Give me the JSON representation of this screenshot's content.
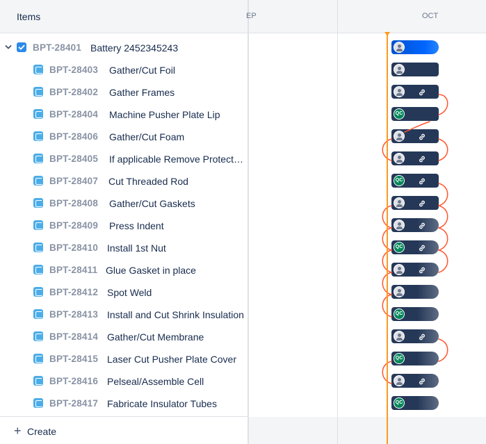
{
  "left_panel": {
    "header_title": "Items",
    "parent": {
      "key": "BPT-28401",
      "summary": "Battery 2452345243"
    },
    "children": [
      {
        "key": "BPT-28403",
        "summary": "Gather/Cut Foil"
      },
      {
        "key": "BPT-28402",
        "summary": "Gather Frames"
      },
      {
        "key": "BPT-28404",
        "summary": "Machine Pusher Plate Lip"
      },
      {
        "key": "BPT-28406",
        "summary": "Gather/Cut Foam"
      },
      {
        "key": "BPT-28405",
        "summary": "If applicable Remove Protect…"
      },
      {
        "key": "BPT-28407",
        "summary": "Cut Threaded Rod"
      },
      {
        "key": "BPT-28408",
        "summary": "Gather/Cut Gaskets"
      },
      {
        "key": "BPT-28409",
        "summary": "Press Indent"
      },
      {
        "key": "BPT-28410",
        "summary": "Install 1st Nut"
      },
      {
        "key": "BPT-28411",
        "summary": "Glue Gasket in place"
      },
      {
        "key": "BPT-28412",
        "summary": "Spot Weld"
      },
      {
        "key": "BPT-28413",
        "summary": "Install and Cut Shrink Insulation"
      },
      {
        "key": "BPT-28414",
        "summary": "Gather/Cut Membrane"
      },
      {
        "key": "BPT-28415",
        "summary": "Laser Cut Pusher Plate Cover"
      },
      {
        "key": "BPT-28416",
        "summary": "Pelseal/Assemble Cell"
      },
      {
        "key": "BPT-28417",
        "summary": "Fabricate Insulator Tubes"
      }
    ],
    "create_label": "Create"
  },
  "timeline": {
    "months": {
      "sep_partial": "EP",
      "oct": "OCT"
    },
    "bars": [
      {
        "style": "blue",
        "badge": "avatar",
        "link": false
      },
      {
        "style": "dark",
        "badge": "avatar",
        "link": false
      },
      {
        "style": "dark",
        "badge": "avatar",
        "link": true
      },
      {
        "style": "dark",
        "badge": "qc",
        "link": false
      },
      {
        "style": "dark",
        "badge": "avatar",
        "link": true
      },
      {
        "style": "dark",
        "badge": "avatar",
        "link": true
      },
      {
        "style": "dark",
        "badge": "qc",
        "link": true
      },
      {
        "style": "dark",
        "badge": "avatar",
        "link": true
      },
      {
        "style": "fade",
        "badge": "avatar",
        "link": true
      },
      {
        "style": "fade",
        "badge": "qc",
        "link": true
      },
      {
        "style": "fade",
        "badge": "avatar",
        "link": true
      },
      {
        "style": "fade",
        "badge": "avatar",
        "link": false
      },
      {
        "style": "fade",
        "badge": "qc",
        "link": false
      },
      {
        "style": "fade",
        "badge": "avatar",
        "link": true
      },
      {
        "style": "fade",
        "badge": "qc",
        "link": false
      },
      {
        "style": "fade",
        "badge": "avatar",
        "link": true
      },
      {
        "style": "fade",
        "badge": "qc",
        "link": false
      }
    ],
    "qc_badge_text": "QC"
  },
  "colors": {
    "accent": "#0052cc",
    "bar_dark": "#253858",
    "today_line": "#ff991f",
    "dependency_line": "#ff5630",
    "qc_badge": "#00875a"
  }
}
